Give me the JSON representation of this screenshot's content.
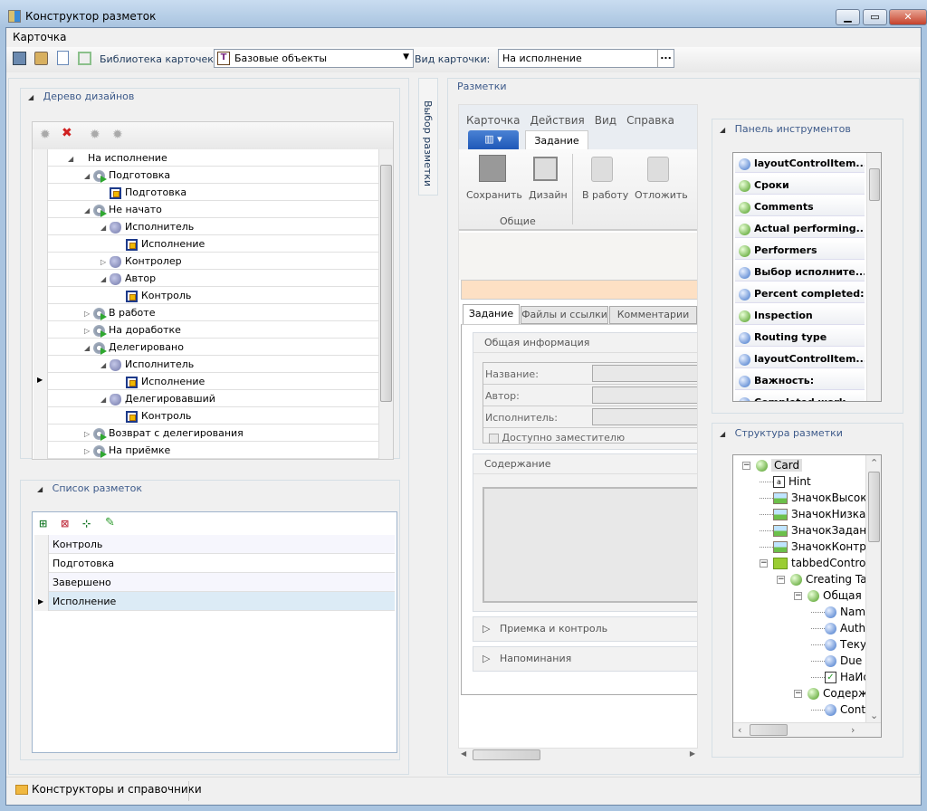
{
  "window": {
    "title": "Конструктор разметок",
    "controls": [
      "minimize",
      "maximize",
      "close"
    ]
  },
  "menu": {
    "items": [
      "Карточка"
    ]
  },
  "toolbar": {
    "library_label": "Библиотека карточек:",
    "library_value": "Базовые объекты",
    "view_label": "Вид карточки:",
    "view_value": "На исполнение",
    "more": "..."
  },
  "left": {
    "design_tree": {
      "title": "Дерево дизайнов",
      "rows": [
        {
          "label": "На исполнение",
          "level": 0,
          "icon": "none",
          "exp": "open"
        },
        {
          "label": "Подготовка",
          "level": 1,
          "icon": "state",
          "exp": "open"
        },
        {
          "label": "Подготовка",
          "level": 2,
          "icon": "form",
          "exp": ""
        },
        {
          "label": "Не начато",
          "level": 1,
          "icon": "state",
          "exp": "open"
        },
        {
          "label": "Исполнитель",
          "level": 2,
          "icon": "role",
          "exp": "open"
        },
        {
          "label": "Исполнение",
          "level": 3,
          "icon": "form",
          "exp": ""
        },
        {
          "label": "Контролер",
          "level": 2,
          "icon": "role",
          "exp": "closed"
        },
        {
          "label": "Автор",
          "level": 2,
          "icon": "role",
          "exp": "open"
        },
        {
          "label": "Контроль",
          "level": 3,
          "icon": "form",
          "exp": ""
        },
        {
          "label": "В работе",
          "level": 1,
          "icon": "state",
          "exp": "closed"
        },
        {
          "label": "На доработке",
          "level": 1,
          "icon": "state",
          "exp": "closed"
        },
        {
          "label": "Делегировано",
          "level": 1,
          "icon": "state",
          "exp": "open"
        },
        {
          "label": "Исполнитель",
          "level": 2,
          "icon": "role",
          "exp": "open"
        },
        {
          "label": "Исполнение",
          "level": 3,
          "icon": "form",
          "exp": "",
          "current": true
        },
        {
          "label": "Делегировавший",
          "level": 2,
          "icon": "role",
          "exp": "open"
        },
        {
          "label": "Контроль",
          "level": 3,
          "icon": "form",
          "exp": ""
        },
        {
          "label": "Возврат с делегирования",
          "level": 1,
          "icon": "state",
          "exp": "closed"
        },
        {
          "label": "На приёмке",
          "level": 1,
          "icon": "state",
          "exp": "closed"
        }
      ]
    },
    "layout_list": {
      "title": "Список разметок",
      "rows": [
        "Контроль",
        "Подготовка",
        "Завершено",
        "Исполнение"
      ],
      "selected": 3
    }
  },
  "side_tab": "Выбор разметки",
  "middle": {
    "title": "Разметки",
    "card_menu": [
      "Карточка",
      "Действия",
      "Вид",
      "Справка"
    ],
    "ribbon_tab": "Задание",
    "ribbon_buttons": [
      "Сохранить",
      "Дизайн",
      "В работу",
      "Отложить"
    ],
    "ribbon_group": "Общие",
    "tabs": [
      "Задание",
      "Файлы и ссылки",
      "Комментарии"
    ],
    "general": "Общая информация",
    "fields": [
      "Название:",
      "Автор:",
      "Исполнитель:"
    ],
    "checkbox": "Доступно заместителю",
    "content": "Содержание",
    "collapsed": [
      "Приемка и контроль",
      "Напоминания"
    ]
  },
  "toolbox": {
    "title": "Панель инструментов",
    "items": [
      {
        "label": "layoutControlItem...",
        "icon": "item"
      },
      {
        "label": "Сроки",
        "icon": "group"
      },
      {
        "label": "Comments",
        "icon": "group"
      },
      {
        "label": "Actual performing...",
        "icon": "group"
      },
      {
        "label": "Performers",
        "icon": "group"
      },
      {
        "label": "Выбор исполните...",
        "icon": "item"
      },
      {
        "label": "Percent completed:",
        "icon": "item"
      },
      {
        "label": "Inspection",
        "icon": "group"
      },
      {
        "label": "Routing type",
        "icon": "item"
      },
      {
        "label": "layoutControlItem...",
        "icon": "item"
      },
      {
        "label": "Важность:",
        "icon": "item"
      },
      {
        "label": "Completed work",
        "icon": "item"
      }
    ]
  },
  "structure": {
    "title": "Структура разметки",
    "nodes": [
      {
        "label": "Card",
        "level": 0,
        "icon": "group",
        "exp": "-"
      },
      {
        "label": "Hint",
        "level": 1,
        "icon": "label",
        "exp": ""
      },
      {
        "label": "ЗначокВысокая",
        "level": 1,
        "icon": "image",
        "exp": ""
      },
      {
        "label": "ЗначокНизкаяВ",
        "level": 1,
        "icon": "image",
        "exp": ""
      },
      {
        "label": "ЗначокЗадание",
        "level": 1,
        "icon": "image",
        "exp": ""
      },
      {
        "label": "ЗначокКонтроль",
        "level": 1,
        "icon": "image",
        "exp": ""
      },
      {
        "label": "tabbedControlGroup",
        "level": 1,
        "icon": "folder",
        "exp": "-"
      },
      {
        "label": "Creating Task",
        "level": 2,
        "icon": "group",
        "exp": "-"
      },
      {
        "label": "Общая информация",
        "level": 3,
        "icon": "group",
        "exp": "-"
      },
      {
        "label": "Name",
        "level": 4,
        "icon": "item",
        "exp": ""
      },
      {
        "label": "Author",
        "level": 4,
        "icon": "item",
        "exp": ""
      },
      {
        "label": "Текущий",
        "level": 4,
        "icon": "item",
        "exp": ""
      },
      {
        "label": "Due date",
        "level": 4,
        "icon": "item",
        "exp": ""
      },
      {
        "label": "НаИсполнение",
        "level": 4,
        "icon": "check",
        "exp": ""
      },
      {
        "label": "Содержание",
        "level": 3,
        "icon": "group",
        "exp": "-"
      },
      {
        "label": "Content",
        "level": 4,
        "icon": "item",
        "exp": ""
      }
    ]
  },
  "statusbar": {
    "item": "Конструкторы и справочники"
  }
}
